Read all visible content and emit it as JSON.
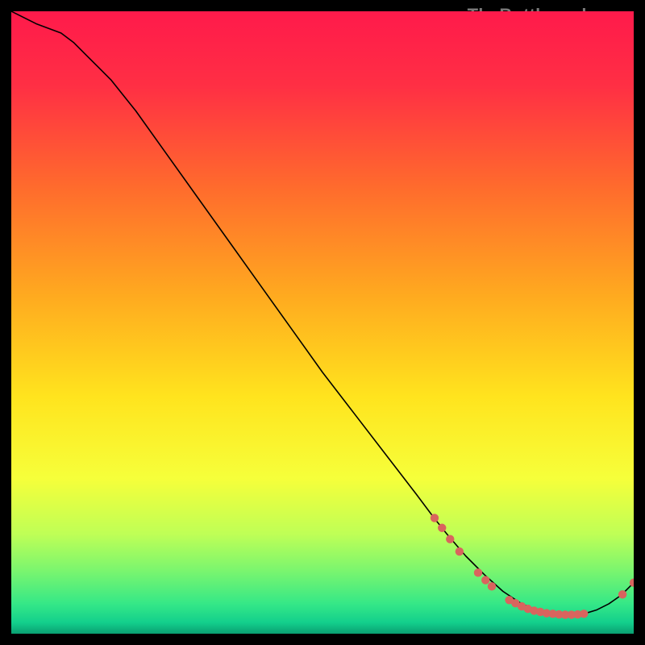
{
  "watermark": "TheBottleneck.com",
  "chart_data": {
    "type": "line",
    "title": "",
    "xlabel": "",
    "ylabel": "",
    "xlim": [
      0,
      100
    ],
    "ylim": [
      0,
      100
    ],
    "grid": false,
    "legend": false,
    "gradient_stops": [
      {
        "offset": 0.0,
        "color": "#ff1a4b"
      },
      {
        "offset": 0.12,
        "color": "#ff2f44"
      },
      {
        "offset": 0.28,
        "color": "#ff6a2d"
      },
      {
        "offset": 0.46,
        "color": "#ffab1f"
      },
      {
        "offset": 0.62,
        "color": "#ffe41e"
      },
      {
        "offset": 0.75,
        "color": "#f6ff3a"
      },
      {
        "offset": 0.84,
        "color": "#bfff56"
      },
      {
        "offset": 0.9,
        "color": "#79f56f"
      },
      {
        "offset": 0.952,
        "color": "#35e887"
      },
      {
        "offset": 0.982,
        "color": "#13cf8c"
      },
      {
        "offset": 1.0,
        "color": "#0a9f72"
      }
    ],
    "series": [
      {
        "name": "curve",
        "color": "#000000",
        "stroke_width": 1.6,
        "x": [
          0,
          4,
          8,
          10,
          12,
          14,
          16,
          20,
          25,
          30,
          35,
          40,
          45,
          50,
          55,
          60,
          65,
          68,
          70,
          73,
          76,
          79,
          82,
          85,
          88,
          90,
          92,
          94,
          96,
          98,
          100
        ],
        "y": [
          100,
          98,
          96.5,
          95,
          93,
          91,
          89,
          84,
          77,
          70,
          63,
          56,
          49,
          42,
          35.5,
          29,
          22.5,
          18.5,
          16,
          12.5,
          9.5,
          6.8,
          4.8,
          3.6,
          3.0,
          3.0,
          3.2,
          3.8,
          4.8,
          6.2,
          8.2
        ]
      }
    ],
    "markers": {
      "name": "highlight-points",
      "color": "#d9645e",
      "radius": 5.2,
      "points": [
        {
          "x": 68.0,
          "y": 18.6
        },
        {
          "x": 69.2,
          "y": 17.0
        },
        {
          "x": 70.5,
          "y": 15.2
        },
        {
          "x": 72.0,
          "y": 13.2
        },
        {
          "x": 75.0,
          "y": 9.8
        },
        {
          "x": 76.2,
          "y": 8.6
        },
        {
          "x": 77.2,
          "y": 7.6
        },
        {
          "x": 80.0,
          "y": 5.4
        },
        {
          "x": 81.0,
          "y": 4.9
        },
        {
          "x": 82.0,
          "y": 4.4
        },
        {
          "x": 83.0,
          "y": 4.0
        },
        {
          "x": 84.0,
          "y": 3.7
        },
        {
          "x": 85.0,
          "y": 3.5
        },
        {
          "x": 86.0,
          "y": 3.3
        },
        {
          "x": 87.0,
          "y": 3.2
        },
        {
          "x": 88.0,
          "y": 3.1
        },
        {
          "x": 89.0,
          "y": 3.05
        },
        {
          "x": 90.0,
          "y": 3.05
        },
        {
          "x": 91.0,
          "y": 3.1
        },
        {
          "x": 92.0,
          "y": 3.2
        },
        {
          "x": 98.2,
          "y": 6.3
        },
        {
          "x": 100.0,
          "y": 8.2
        }
      ]
    }
  }
}
